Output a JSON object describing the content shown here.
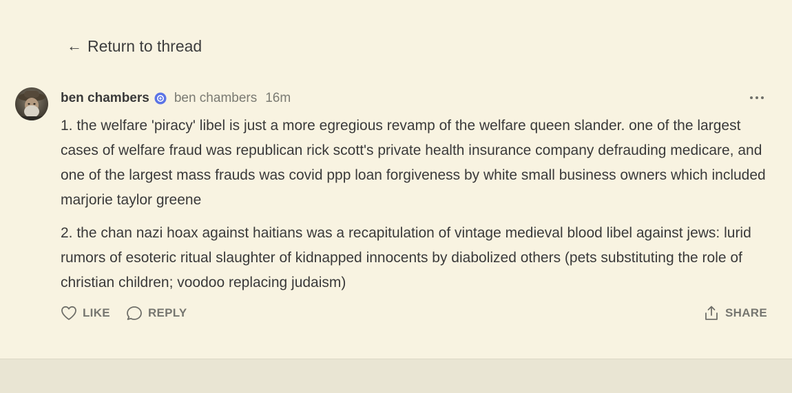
{
  "nav": {
    "back_arrow": "←",
    "back_label": "Return to thread"
  },
  "post": {
    "author": "ben chambers",
    "handle": "ben chambers",
    "time": "16m",
    "paragraphs": [
      "1. the welfare 'piracy' libel is just a more egregious revamp of the welfare queen slander. one of the largest cases of welfare fraud was republican rick scott's private health insurance company defrauding medicare, and one of the largest mass frauds was covid ppp loan forgiveness by white small business owners which included marjorie taylor greene",
      "2. the chan nazi hoax against haitians was a recapitulation of vintage medieval blood libel against jews: lurid rumors of esoteric ritual slaughter of kidnapped innocents by diabolized others (pets substituting the role of christian children; voodoo replacing judaism)"
    ]
  },
  "actions": {
    "like_label": "LIKE",
    "reply_label": "REPLY",
    "share_label": "SHARE"
  },
  "icons": {
    "back": "arrow-left-icon",
    "verified": "verified-badge-icon",
    "more": "more-horizontal-icon",
    "like": "heart-icon",
    "reply": "speech-bubble-icon",
    "share": "share-upload-icon"
  },
  "colors": {
    "background": "#f8f3e1",
    "footer_band": "#e9e5d3",
    "text": "#3a3a3a",
    "muted": "#767670",
    "verified": "#5b74e6"
  }
}
